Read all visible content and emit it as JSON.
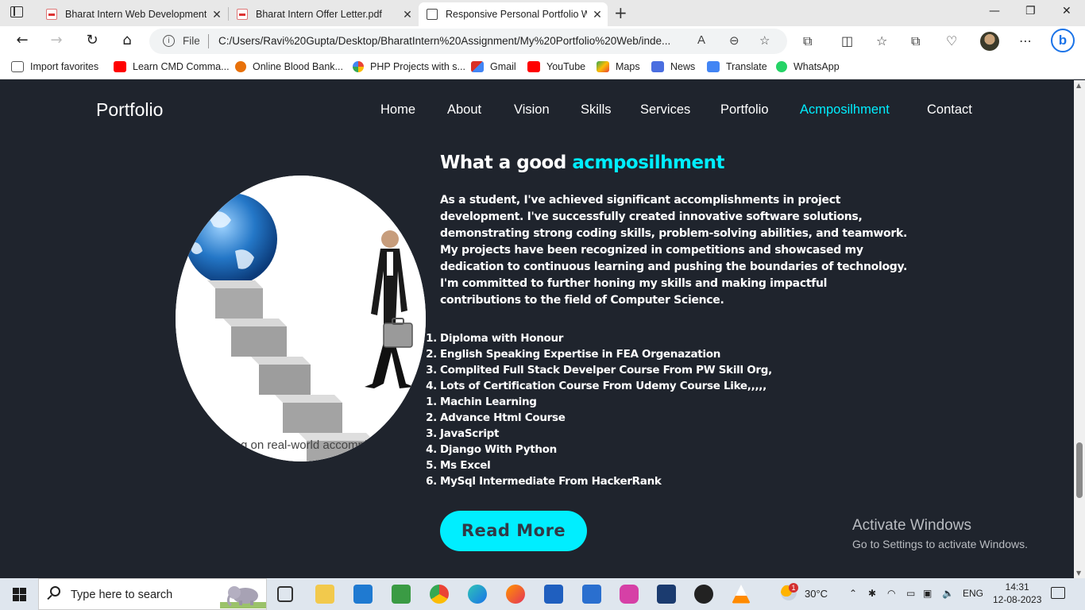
{
  "browser": {
    "tabs": [
      {
        "label": "Bharat Intern Web Development..."
      },
      {
        "label": "Bharat Intern Offer Letter.pdf"
      },
      {
        "label": "Responsive Personal Portfolio We..."
      }
    ],
    "address": {
      "scheme_label": "File",
      "url": "C:/Users/Ravi%20Gupta/Desktop/BharatIntern%20Assignment/My%20Portfolio%20Web/inde..."
    },
    "favorites": [
      {
        "label": "Import favorites",
        "icon": "import-icon",
        "color": "#555555"
      },
      {
        "label": "Learn CMD Comma...",
        "icon": "youtube-icon",
        "color": "#ff0000"
      },
      {
        "label": "Online Blood Bank...",
        "icon": "site-icon",
        "color": "#e8710a"
      },
      {
        "label": "PHP Projects with s...",
        "icon": "google-icon",
        "color": "#4285f4"
      },
      {
        "label": "Gmail",
        "icon": "gmail-icon",
        "color": "#d93025"
      },
      {
        "label": "YouTube",
        "icon": "youtube-icon",
        "color": "#ff0000"
      },
      {
        "label": "Maps",
        "icon": "maps-icon",
        "color": "#34a853"
      },
      {
        "label": "News",
        "icon": "news-icon",
        "color": "#4a6ee0"
      },
      {
        "label": "Translate",
        "icon": "translate-icon",
        "color": "#4285f4"
      },
      {
        "label": "WhatsApp",
        "icon": "whatsapp-icon",
        "color": "#25d366"
      }
    ]
  },
  "page": {
    "logo": "Portfolio",
    "nav": [
      "Home",
      "About",
      "Vision",
      "Skills",
      "Services",
      "Portfolio",
      "Acmposilhment",
      "Contact"
    ],
    "active_nav": "Acmposilhment",
    "heading_prefix": "What a good ",
    "heading_accent": "acmposilhment",
    "paragraph": "As a student, I've achieved significant accomplishments in project development. I've successfully created innovative software solutions, demonstrating strong coding skills, problem-solving abilities, and teamwork. My projects have been recognized in competitions and showcased my dedication to continuous learning and pushing the boundaries of technology. I'm committed to further honing my skills and making impactful contributions to the field of Computer Science.",
    "image_caption": "g on real-world accompli",
    "list": [
      {
        "num": "1.",
        "text": "Diploma with Honour"
      },
      {
        "num": "2.",
        "text": "English Speaking Expertise in FEA Orgenazation"
      },
      {
        "num": "3.",
        "text": "Complited Full Stack Develper Course From PW Skill Org,"
      },
      {
        "num": "4.",
        "text": "Lots of Certification Course From Udemy Course Like,,,,,"
      },
      {
        "num": "1.",
        "text": "Machin Learning"
      },
      {
        "num": "2.",
        "text": "Advance Html Course"
      },
      {
        "num": "3.",
        "text": "JavaScript"
      },
      {
        "num": "4.",
        "text": "Django With Python"
      },
      {
        "num": "5.",
        "text": "Ms Excel"
      },
      {
        "num": "6.",
        "text": "MySql Intermediate From HackerRank"
      }
    ],
    "read_more": "Read More",
    "accent_color": "#00eeff",
    "bg_color": "#1f242d"
  },
  "watermark": {
    "line1": "Activate Windows",
    "line2": "Go to Settings to activate Windows."
  },
  "taskbar": {
    "search_placeholder": "Type here to search",
    "weather": "30°C",
    "language": "ENG",
    "time": "14:31",
    "date": "12-08-2023",
    "mail_badge": "1"
  }
}
